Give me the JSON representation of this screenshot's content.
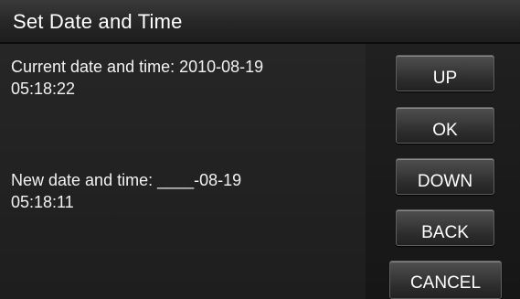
{
  "title": "Set Date and Time",
  "current": {
    "line1": "Current date and time: 2010-08-19",
    "line2": "05:18:22"
  },
  "new": {
    "line1": "New date and time: ____-08-19",
    "line2": "05:18:11"
  },
  "buttons": {
    "up": "UP",
    "ok": "OK",
    "down": "DOWN",
    "back": "BACK",
    "cancel": "CANCEL"
  }
}
